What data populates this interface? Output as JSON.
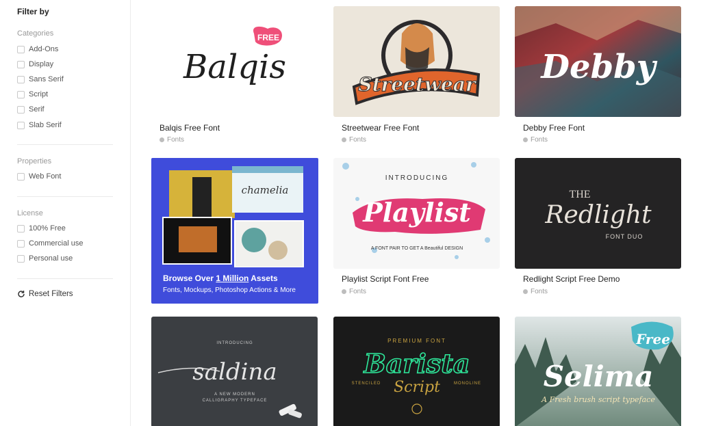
{
  "sidebar": {
    "title": "Filter by",
    "categories_title": "Categories",
    "categories": [
      "Add-Ons",
      "Display",
      "Sans Serif",
      "Script",
      "Serif",
      "Slab Serif"
    ],
    "properties_title": "Properties",
    "properties": [
      "Web Font"
    ],
    "license_title": "License",
    "license": [
      "100% Free",
      "Commercial use",
      "Personal use"
    ],
    "reset_label": "Reset Filters"
  },
  "cards": [
    {
      "title": "Balqis Free Font",
      "category": "Fonts",
      "art": "Balqis",
      "badge": "FREE"
    },
    {
      "title": "Streetwear Free Font",
      "category": "Fonts",
      "art": "Streetwear"
    },
    {
      "title": "Debby Free Font",
      "category": "Fonts",
      "art": "Debby"
    },
    {
      "title": "Playlist Script Font Free",
      "category": "Fonts",
      "art_top": "INTRODUCING",
      "art": "Playlist",
      "art_bottom": "A FONT PAIR TO GET A Beautiful DESIGN"
    },
    {
      "title": "Redlight Script Free Demo",
      "category": "Fonts",
      "art_top": "THE",
      "art": "Redlight",
      "art_bottom": "FONT DUO"
    },
    {
      "art_top": "INTRODUCING",
      "art": "saldina",
      "art_bottom": "A NEW MODERN",
      "art_bottom2": "CALLIGRAPHY TYPEFACE"
    },
    {
      "art_top": "PREMIUM FONT",
      "art": "Barista",
      "art_sub": "Script",
      "art_left": "STENCILED",
      "art_right": "MONOLINE"
    },
    {
      "art_top": "Free",
      "art": "Selima",
      "art_bottom": "A Fresh brush script typeface"
    }
  ],
  "promo": {
    "heading_pre": "Browse Over ",
    "heading_link": "1 Million",
    "heading_post": " Assets",
    "subtitle": "Fonts, Mockups, Photoshop Actions & More",
    "thumb_text": "chamelia"
  },
  "colors": {
    "promo_bg": "#3f4cdb",
    "badge": "#ef4f79",
    "barista_green": "#2ee89b",
    "barista_gold": "#c9a341"
  }
}
